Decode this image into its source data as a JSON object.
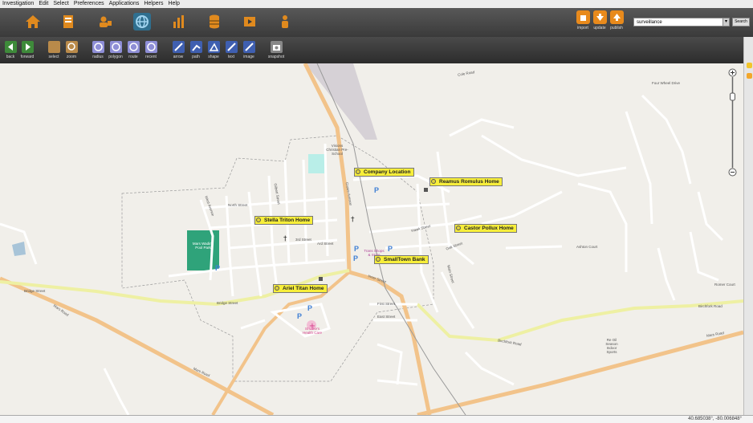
{
  "menu": [
    "Investigation",
    "Edit",
    "Select",
    "Preferences",
    "Applications",
    "Helpers",
    "Help"
  ],
  "nav_icons": [
    "home-icon",
    "report-icon",
    "people-icon",
    "map-globe-icon",
    "chart-icon",
    "database-icon",
    "video-icon",
    "person-icon"
  ],
  "top_actions": [
    {
      "label": "import",
      "icon": "import-icon"
    },
    {
      "label": "update",
      "icon": "update-icon"
    },
    {
      "label": "publish",
      "icon": "publish-icon"
    }
  ],
  "search": {
    "value": "surveillance",
    "button": "Search"
  },
  "tools": [
    {
      "label": "back",
      "icon": "back-arrow-icon"
    },
    {
      "label": "forward",
      "icon": "forward-arrow-icon"
    },
    {
      "label": "select",
      "icon": "select-icon"
    },
    {
      "label": "zoom",
      "icon": "zoom-icon"
    },
    {
      "label": "radius",
      "icon": "radius-icon"
    },
    {
      "label": "polygon",
      "icon": "polygon-icon"
    },
    {
      "label": "route",
      "icon": "route-icon"
    },
    {
      "label": "recent",
      "icon": "recent-icon"
    },
    {
      "label": "arrow",
      "icon": "arrow-icon"
    },
    {
      "label": "path",
      "icon": "path-icon"
    },
    {
      "label": "shape",
      "icon": "shape-icon"
    },
    {
      "label": "text",
      "icon": "text-icon"
    },
    {
      "label": "image",
      "icon": "image-icon"
    },
    {
      "label": "snapshot",
      "icon": "snapshot-icon"
    }
  ],
  "markers": [
    {
      "label": "Company Location"
    },
    {
      "label": "Reamus Romulus Home"
    },
    {
      "label": "Stella Triton Home"
    },
    {
      "label": "Castor Pollux Home"
    },
    {
      "label": "SmallTown Bank"
    },
    {
      "label": "Ariel Titan Home"
    }
  ],
  "road_labels": {
    "mars_road_1": "Mars Road",
    "mars_road_2": "Mars Road",
    "mars_road_3": "Mars Road",
    "bridge_street": "Bridge Street",
    "birchfork_road": "Birchfork Road",
    "inner_street": "Inner Street",
    "north_street": "North Street",
    "third_street": "3rd Street",
    "ard_street": "Ard Street",
    "first_street": "First Street",
    "east_street": "East Street",
    "hawk_street": "Hawk Street",
    "west_avenue": "West Avenue",
    "gilbert_street": "Gilbert Street",
    "crown_avenue": "Crown Avenue",
    "main_street": "Main Street",
    "oak_street": "Oak Street",
    "ashton_court": "Ashton Court",
    "romer_court": "Romer Court",
    "four_wheel_drive": "Four Wheel Drive",
    "cole_road": "Cole Road"
  },
  "poi_labels": {
    "park": "Mars Wading Pool Park",
    "school": "Visions Christian Pre-School",
    "shops": "Trans Shops & Store",
    "health": "St Luke's Health Care",
    "sports": "Re Oil Season Indoor Sports"
  },
  "status": {
    "coords": "40.685038°, -80.006848°"
  },
  "colors": {
    "accent": "#2f6f8f",
    "marker": "#f7ee3a",
    "road_major": "#f2c38a",
    "road_yellow": "#eef0a3",
    "park": "#2fa37a"
  }
}
